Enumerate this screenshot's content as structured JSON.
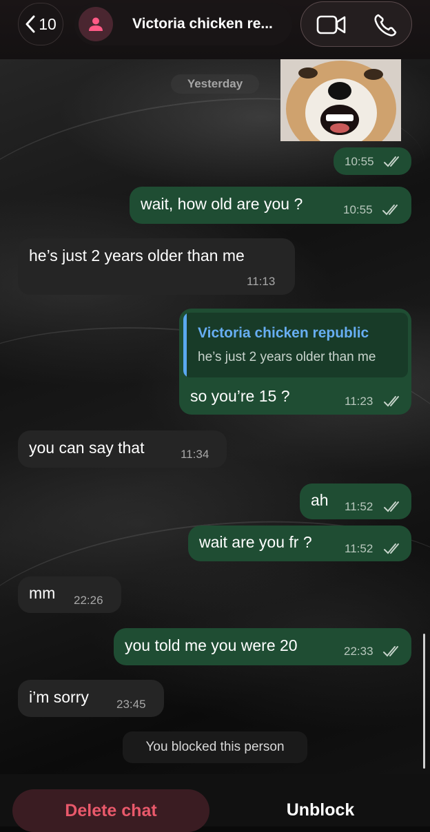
{
  "header": {
    "back_count": "10",
    "title": "Victoria chicken re...",
    "video_icon": "video-camera-icon",
    "phone_icon": "phone-icon",
    "avatar_icon": "person-icon"
  },
  "date_separator": "Yesterday",
  "messages": [
    {
      "dir": "out",
      "kind": "image",
      "time": "10:55",
      "status": "read"
    },
    {
      "dir": "out",
      "text": "wait, how old are you ?",
      "time": "10:55",
      "status": "read"
    },
    {
      "dir": "in",
      "text": "he’s just 2 years older than me",
      "time": "11:13"
    },
    {
      "dir": "out",
      "reply_to": {
        "name": "Victoria chicken republic",
        "text": "he’s just 2 years older than me"
      },
      "text": "so you’re 15 ?",
      "time": "11:23",
      "status": "read"
    },
    {
      "dir": "in",
      "text": "you can say that",
      "time": "11:34"
    },
    {
      "dir": "out",
      "text": "ah",
      "time": "11:52",
      "status": "read"
    },
    {
      "dir": "out",
      "text": "wait are you fr ?",
      "time": "11:52",
      "status": "read"
    },
    {
      "dir": "in",
      "text": "mm",
      "time": "22:26"
    },
    {
      "dir": "out",
      "text": "you told me you were 20",
      "time": "22:33",
      "status": "read"
    },
    {
      "dir": "in",
      "text": "i’m sorry",
      "time": "23:45"
    }
  ],
  "system_notice": "You blocked this person",
  "actions": {
    "delete_label": "Delete chat",
    "unblock_label": "Unblock"
  },
  "colors": {
    "outgoing_bubble": "#1f4d33",
    "incoming_bubble": "#252525",
    "reply_name": "#67aef2",
    "delete_text": "#e9596b"
  }
}
